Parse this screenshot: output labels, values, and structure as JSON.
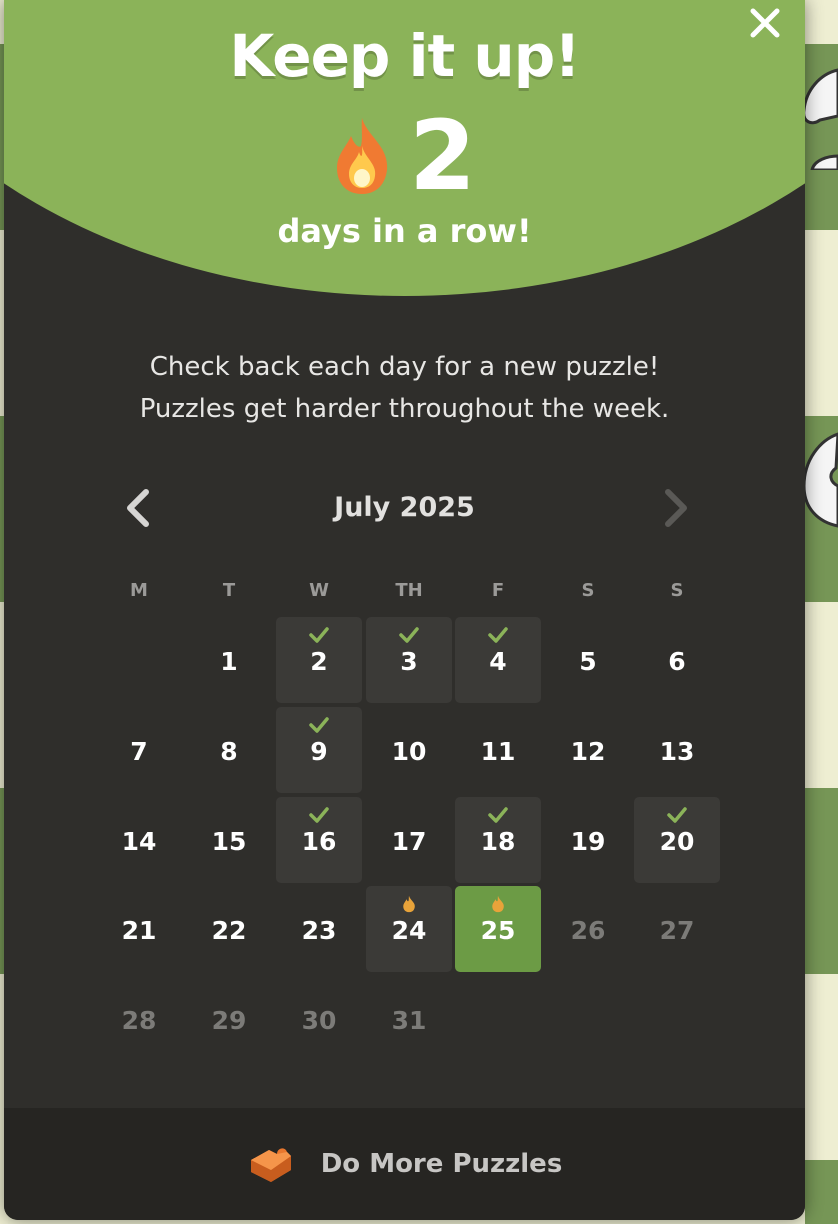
{
  "modal": {
    "title": "Keep it up!",
    "streak_count": "2",
    "streak_subtitle": "days in a row!",
    "message_line1": "Check back each day for a new puzzle!",
    "message_line2": "Puzzles get harder throughout the week.",
    "close_icon": "close-icon"
  },
  "calendar": {
    "month_label": "July 2025",
    "prev_icon": "chevron-left-icon",
    "next_icon": "chevron-right-icon",
    "weekdays": [
      "M",
      "T",
      "W",
      "TH",
      "F",
      "S",
      "S"
    ],
    "days": [
      {
        "day": "1",
        "state": "normal"
      },
      {
        "day": "2",
        "state": "completed"
      },
      {
        "day": "3",
        "state": "completed"
      },
      {
        "day": "4",
        "state": "completed"
      },
      {
        "day": "5",
        "state": "normal"
      },
      {
        "day": "6",
        "state": "normal"
      },
      {
        "day": "7",
        "state": "normal"
      },
      {
        "day": "8",
        "state": "normal"
      },
      {
        "day": "9",
        "state": "completed"
      },
      {
        "day": "10",
        "state": "normal"
      },
      {
        "day": "11",
        "state": "normal"
      },
      {
        "day": "12",
        "state": "normal"
      },
      {
        "day": "13",
        "state": "normal"
      },
      {
        "day": "14",
        "state": "normal"
      },
      {
        "day": "15",
        "state": "normal"
      },
      {
        "day": "16",
        "state": "completed"
      },
      {
        "day": "17",
        "state": "normal"
      },
      {
        "day": "18",
        "state": "completed"
      },
      {
        "day": "19",
        "state": "normal"
      },
      {
        "day": "20",
        "state": "completed"
      },
      {
        "day": "21",
        "state": "normal"
      },
      {
        "day": "22",
        "state": "normal"
      },
      {
        "day": "23",
        "state": "normal"
      },
      {
        "day": "24",
        "state": "streak"
      },
      {
        "day": "25",
        "state": "today-streak"
      },
      {
        "day": "26",
        "state": "future"
      },
      {
        "day": "27",
        "state": "future"
      },
      {
        "day": "28",
        "state": "future"
      },
      {
        "day": "29",
        "state": "future"
      },
      {
        "day": "30",
        "state": "future"
      },
      {
        "day": "31",
        "state": "future"
      }
    ]
  },
  "footer": {
    "label": "Do More Puzzles",
    "icon": "puzzle-piece-icon"
  },
  "colors": {
    "accent_green": "#8bb359",
    "today_green": "#6c9b45",
    "panel": "#2f2e2b",
    "check": "#8bb359",
    "flame": "#e8a33a"
  }
}
